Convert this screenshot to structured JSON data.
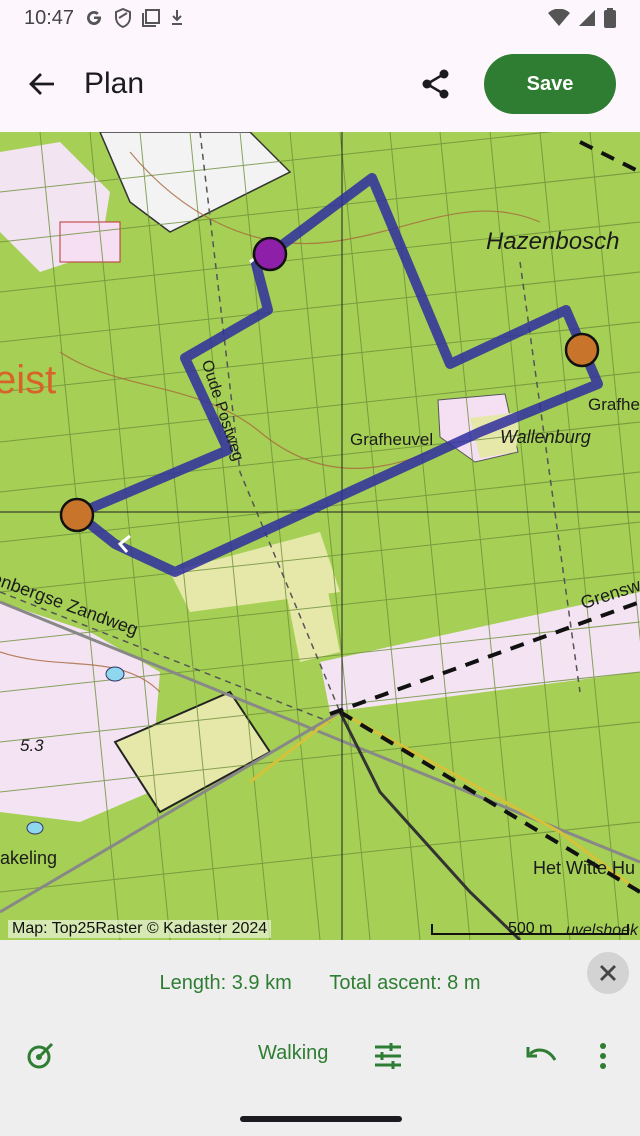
{
  "status_bar": {
    "time": "10:47"
  },
  "app_bar": {
    "title": "Plan",
    "save_label": "Save"
  },
  "map": {
    "labels": {
      "hazenbosch": "Hazenbosch",
      "grafheuvel": "Grafheuvel",
      "wallenburg": "Wallenburg",
      "grafhe_partial": "Grafhe",
      "zeist_partial": "eist",
      "oude_postweg": "Oude Postweg",
      "zandweg": "enbergse Zandweg",
      "grensw": "Grensw",
      "spot_height": "5.3",
      "akeling": "akeling",
      "witte_huis": "Het Witte Hu",
      "velshoek": "uvelshoek"
    },
    "attribution": "Map: Top25Raster © Kadaster 2024",
    "scale_label": "500 m",
    "colors": {
      "route": "#2e2ea0",
      "waypoint": "#c9742b",
      "start_point": "#8e1fa8",
      "forest": "#a5cf55"
    }
  },
  "bottom_sheet": {
    "length_text": "Length: 3.9 km",
    "ascent_text": "Total ascent: 8 m",
    "mode_label": "Walking",
    "accent_color": "#2e7d32"
  }
}
